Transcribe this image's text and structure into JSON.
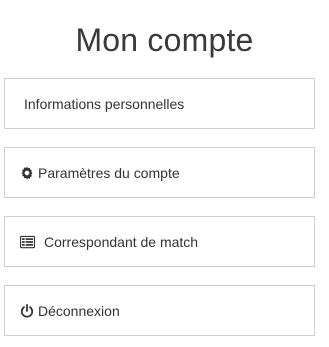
{
  "page": {
    "title": "Mon compte"
  },
  "menu": {
    "items": [
      {
        "label": "Informations personnelles",
        "icon": null
      },
      {
        "label": "Paramètres du compte",
        "icon": "gear-icon"
      },
      {
        "label": "Correspondant de match",
        "icon": "list-icon"
      },
      {
        "label": "Déconnexion",
        "icon": "power-icon"
      }
    ]
  },
  "colors": {
    "text": "#333333",
    "title": "#3a3a3a",
    "border": "#cfcfcf",
    "background": "#ffffff"
  }
}
